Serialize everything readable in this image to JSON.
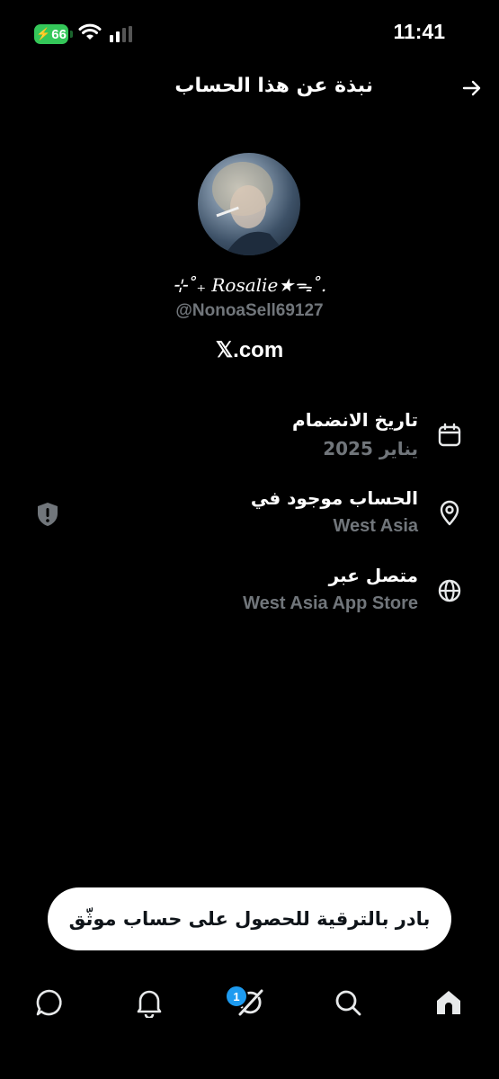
{
  "status_bar": {
    "time": "11:41",
    "battery": "66",
    "battery_color": "#34c759"
  },
  "header": {
    "title": "نبذة عن هذا الحساب",
    "back_icon": "arrow-right-icon"
  },
  "profile": {
    "display_name": "⊹˚₊ 𝑅𝑜𝑠𝑎𝑙𝑖𝑒★ᯓ˚.",
    "handle": "@NonoaSell69127",
    "site": "𝕏.com"
  },
  "info": {
    "joined": {
      "label": "تاريخ الانضمام",
      "value": "يناير 2025",
      "icon": "calendar-icon"
    },
    "location": {
      "label": "الحساب موجود في",
      "value": "West Asia",
      "icon": "location-pin-icon",
      "side_icon": "shield-alert-icon"
    },
    "connected": {
      "label": "متصل عبر",
      "value": "West Asia App Store",
      "icon": "globe-icon"
    }
  },
  "upgrade": {
    "label": "بادر بالترقية للحصول على حساب موثّق"
  },
  "tabbar": {
    "items": [
      "home-icon",
      "search-icon",
      "grok-icon",
      "bell-icon",
      "messages-icon"
    ],
    "grok_badge": "1",
    "accent": "#1d9bf0"
  }
}
